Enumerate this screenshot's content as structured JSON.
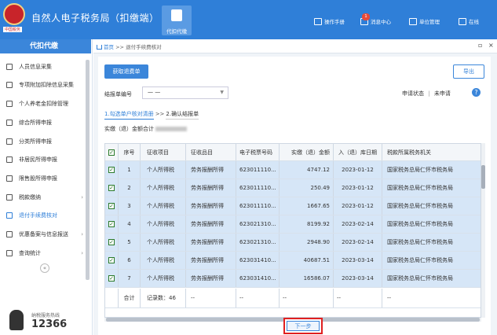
{
  "header": {
    "logo_text": "中国税务",
    "title": "自然人电子税务局（扣缴端）",
    "active_tab": "代扣代缴",
    "nav": [
      {
        "label": "操作手册",
        "icon": "manual-icon"
      },
      {
        "label": "消息中心",
        "icon": "message-icon",
        "badge": "1"
      },
      {
        "label": "单位管理",
        "icon": "building-icon"
      },
      {
        "label": "在线",
        "icon": "online-icon"
      }
    ]
  },
  "sidebar": {
    "title": "代扣代缴",
    "items": [
      {
        "label": "人员信息采集",
        "icon": "person-icon"
      },
      {
        "label": "专项附加扣除信息采集",
        "icon": "form-icon"
      },
      {
        "label": "个人养老金扣除管理",
        "icon": "pension-icon"
      },
      {
        "label": "综合所得申报",
        "icon": "stack-icon"
      },
      {
        "label": "分类所得申报",
        "icon": "category-icon"
      },
      {
        "label": "非居民所得申报",
        "icon": "nonresident-icon"
      },
      {
        "label": "限售股所得申报",
        "icon": "stock-icon"
      },
      {
        "label": "税款缴纳",
        "icon": "wallet-icon"
      },
      {
        "label": "退付手续费核对",
        "icon": "refund-icon",
        "active": true
      },
      {
        "label": "优惠备案与信息报送",
        "icon": "report-icon"
      },
      {
        "label": "查询统计",
        "icon": "search-stat-icon"
      }
    ],
    "hotline_label": "纳税服务热线",
    "hotline_number": "12366"
  },
  "breadcrumb": {
    "home": "首页",
    "separator": ">>",
    "current": "退付手续费核对"
  },
  "panel": {
    "fetch_button": "获取退费单",
    "export_button": "导出",
    "filter_label": "结报单编号",
    "filter_value": "一 一",
    "status_label": "申请状态",
    "status_sep": "|",
    "status_value": "未申请",
    "help": "?",
    "steps": [
      "1.勾选单户核对清册",
      "2.确认结报单"
    ],
    "step_sep": ">>",
    "total_label": "实缴（退）金额合计"
  },
  "table": {
    "columns": [
      "",
      "序号",
      "征收项目",
      "征收品目",
      "电子税票号码",
      "实缴（退）金额",
      "入（退）库日期",
      "税款所属税务机关"
    ],
    "rows": [
      {
        "no": "1",
        "item": "个人所得税",
        "sub": "劳务报酬所得",
        "ticket": "623011110...",
        "amount": "4747.12",
        "date": "2023-01-12",
        "office": "国家税务总局仁怀市税务局"
      },
      {
        "no": "2",
        "item": "个人所得税",
        "sub": "劳务报酬所得",
        "ticket": "623011110...",
        "amount": "250.49",
        "date": "2023-01-12",
        "office": "国家税务总局仁怀市税务局"
      },
      {
        "no": "3",
        "item": "个人所得税",
        "sub": "劳务报酬所得",
        "ticket": "623011110...",
        "amount": "1667.65",
        "date": "2023-01-12",
        "office": "国家税务总局仁怀市税务局"
      },
      {
        "no": "4",
        "item": "个人所得税",
        "sub": "劳务报酬所得",
        "ticket": "623021310...",
        "amount": "8199.92",
        "date": "2023-02-14",
        "office": "国家税务总局仁怀市税务局"
      },
      {
        "no": "5",
        "item": "个人所得税",
        "sub": "劳务报酬所得",
        "ticket": "623021310...",
        "amount": "2948.90",
        "date": "2023-02-14",
        "office": "国家税务总局仁怀市税务局"
      },
      {
        "no": "6",
        "item": "个人所得税",
        "sub": "劳务报酬所得",
        "ticket": "623031410...",
        "amount": "40687.51",
        "date": "2023-03-14",
        "office": "国家税务总局仁怀市税务局"
      },
      {
        "no": "7",
        "item": "个人所得税",
        "sub": "劳务报酬所得",
        "ticket": "623031410...",
        "amount": "16586.07",
        "date": "2023-03-14",
        "office": "国家税务总局仁怀市税务局"
      }
    ],
    "footer": {
      "label": "合计",
      "count": "记录数：46",
      "dash": "--"
    }
  },
  "next_button": "下一步",
  "colors": {
    "primary": "#2f7fd8",
    "row_selected": "#d6e6f7",
    "highlight_border": "#e02020"
  }
}
